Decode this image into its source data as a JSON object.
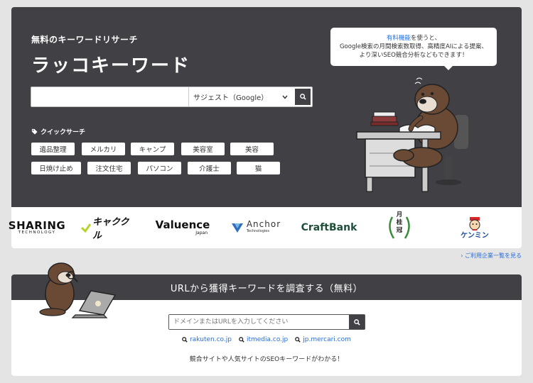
{
  "hero": {
    "eyebrow": "無料のキーワードリサーチ",
    "title": "ラッコキーワード",
    "search_value": "",
    "search_mode": "サジェスト（Google）",
    "quick_label": "クイックサーチ",
    "quick_chips": [
      "遺品整理",
      "メルカリ",
      "キャンプ",
      "美容室",
      "美容",
      "日焼け止め",
      "注文住宅",
      "パソコン",
      "介護士",
      "猫"
    ]
  },
  "bubble": {
    "link": "有料機能",
    "line1_rest": "を使うと、",
    "line2": "Google検索の月間検索数取得、高精度AIによる提案、",
    "line3": "より深いSEO競合分析などもできます！"
  },
  "logos": {
    "sharing_top": "SHARING",
    "sharing_bottom": "TECHNOLOGY",
    "kyakukuru": "キャククル",
    "valuence": "Valuence",
    "valuence_sub": "Japan",
    "anchor": "Anchor",
    "anchor_sub": "Technologies",
    "craftbank": "CraftBank",
    "gekkeikan": [
      "月",
      "桂",
      "冠"
    ],
    "kenmin": "ケンミン"
  },
  "see_all": "ご利用企業一覧を見る",
  "url_section": {
    "title": "URLから獲得キーワードを調査する（無料）",
    "placeholder": "ドメインまたはURLを入力してください",
    "examples": [
      "rakuten.co.jp",
      "itmedia.co.jp",
      "jp.mercari.com"
    ],
    "tagline": "競合サイトや人気サイトのSEOキーワードがわかる！"
  },
  "colors": {
    "dark": "#404045",
    "link": "#2a6fd6",
    "kenmin_red": "#d8262b",
    "kenmin_blue": "#1d4fa0"
  },
  "icons": [
    "search-icon",
    "chevron-down-icon",
    "tag-icon",
    "chevron-right-icon"
  ]
}
